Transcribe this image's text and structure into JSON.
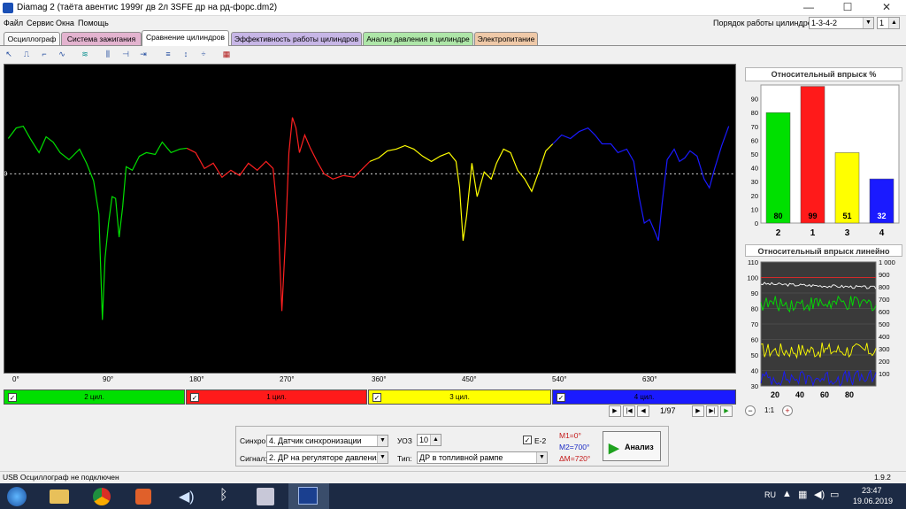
{
  "window": {
    "title": "Diamag 2 (таёта авентис 1999г дв 2л 3SFE др на рд-форс.dm2)"
  },
  "menu": [
    "Файл",
    "Сервис",
    "Окна",
    "Помощь"
  ],
  "cyl_order": {
    "label": "Порядок работы цилиндров",
    "value": "1-3-4-2",
    "num": "1"
  },
  "tabs": [
    {
      "label": "Осциллограф",
      "color": "#f7f7f7"
    },
    {
      "label": "Система зажигания",
      "color": "#e3b3cf"
    },
    {
      "label": "Сравнение цилиндров",
      "color": "#ffffff"
    },
    {
      "label": "Эффективность работы цилиндров",
      "color": "#c7b6e6"
    },
    {
      "label": "Анализ давления в цилиндре",
      "color": "#aee6a8"
    },
    {
      "label": "Электропитание",
      "color": "#efc9a8"
    }
  ],
  "axis": {
    "zero": "0",
    "ticks": [
      "0°",
      "90°",
      "180°",
      "270°",
      "360°",
      "450°",
      "540°",
      "630°"
    ]
  },
  "cylinders": [
    {
      "label": "2 цил.",
      "color": "#00e000",
      "checked": "✓"
    },
    {
      "label": "1 цил.",
      "color": "#ff1a1a",
      "checked": "✓"
    },
    {
      "label": "3 цил.",
      "color": "#ffff00",
      "checked": "✓"
    },
    {
      "label": "4 цил.",
      "color": "#1a1aff",
      "checked": "✓"
    }
  ],
  "nav": {
    "page": "1/97"
  },
  "bar_panel": {
    "title": "Относительный впрыск %",
    "chart_data": {
      "type": "bar",
      "categories": [
        "2",
        "1",
        "3",
        "4"
      ],
      "values": [
        80,
        99,
        51,
        32
      ],
      "colors": [
        "#00e000",
        "#ff1a1a",
        "#ffff00",
        "#1a1aff"
      ],
      "ylim": [
        0,
        100
      ],
      "yticks": [
        "0",
        "10",
        "20",
        "30",
        "40",
        "50",
        "60",
        "70",
        "80",
        "90"
      ]
    }
  },
  "line_panel": {
    "title": "Относительный впрыск линейно",
    "chart_data": {
      "type": "line",
      "ylim_left": [
        30,
        110
      ],
      "ylim_right": [
        0,
        1000
      ],
      "yticks_left": [
        "30",
        "40",
        "50",
        "60",
        "70",
        "80",
        "90",
        "100",
        "110"
      ],
      "yticks_right": [
        "100",
        "200",
        "300",
        "400",
        "500",
        "600",
        "700",
        "800",
        "900",
        "1 000"
      ],
      "xticks": [
        "20",
        "40",
        "60",
        "80"
      ],
      "series": [
        {
          "color": "#ffffff",
          "level": 96
        },
        {
          "color": "#00e000",
          "level": 83
        },
        {
          "color": "#ffff00",
          "level": 53
        },
        {
          "color": "#1a1aff",
          "level": 35
        }
      ],
      "red_line": 100
    },
    "zoom": "1:1"
  },
  "controls": {
    "sync_label": "Синхро:",
    "sync_value": "4. Датчик синхронизации",
    "signal_label": "Сигнал:",
    "signal_value": "2. ДР на регуляторе давления",
    "uoz_label": "УОЗ",
    "uoz_value": "10",
    "type_label": "Тип:",
    "type_value": "ДР в топливной рампе",
    "e2_label": "Е-2",
    "m1": "M1=0°",
    "m2": "M2=700°",
    "dm": "ΔM=720°",
    "analyze": "Анализ"
  },
  "status": {
    "left": "USB Осциллограф не подключен",
    "version": "1.9.2"
  },
  "taskbar": {
    "lang": "RU",
    "time": "23:47",
    "date": "19.06.2019"
  }
}
